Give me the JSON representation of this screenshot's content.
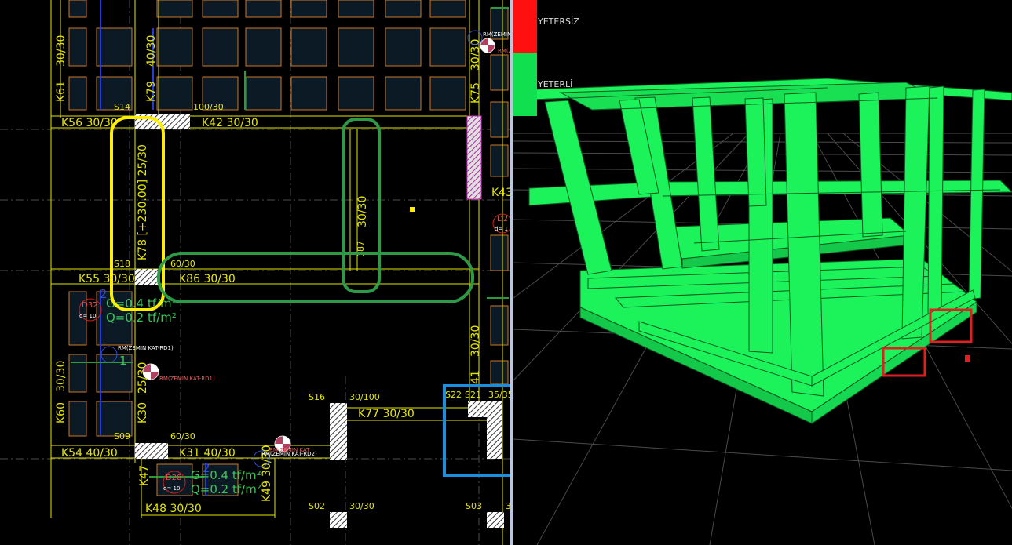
{
  "plan": {
    "beams": {
      "k56": "K56 30/30",
      "k42": "K42   30/30",
      "k55": "K55 30/30",
      "k86": "K86   30/30",
      "k54": "K54 40/30",
      "k31": "K31   40/30",
      "k77": "K77   30/30",
      "k48": "K48   30/30",
      "k61": "K61",
      "k61_size": "30/30",
      "k79": "K79",
      "k79_size": "40/30",
      "k78": "K78 [+230.00]   25/30",
      "k60": "K60",
      "k60_size": "30/30",
      "k30": "K30",
      "k30_size": "25/30",
      "k75": "K75",
      "k75_size": "30/30",
      "k41": "41",
      "k41_size": "30/30",
      "k43": "K43",
      "k47": "K47",
      "k49": "K49",
      "k49_size": "30/30",
      "mid_vertical_size": "30/30",
      "mid_vertical_dim": "187"
    },
    "columns": {
      "s14": "S14",
      "s14_size": "100/30",
      "s18": "S18",
      "s18_size": "60/30",
      "s09": "S09",
      "s09_size": "60/30",
      "s16": "S16",
      "s16_size": "30/100",
      "s22": "S22",
      "s21": "S21",
      "s21_size": "35/35",
      "s02": "S02",
      "s02_size": "30/30",
      "s03": "S03",
      "s03_size": "3"
    },
    "slabs": {
      "d32": "D32",
      "d32_thk": "d= 10",
      "d28": "D28",
      "d28_thk": "d= 10",
      "d2x": "D2",
      "d2x_thk": "d= 1",
      "g1": "G=0.4  tf/m²",
      "q1": "Q=0.2  tf/m²",
      "g2": "G=0.4  tf/m²",
      "q2": "Q=0.2  tf/m²",
      "mark_2a": "2",
      "mark_1a": "1",
      "mark_2b": "2"
    },
    "rm_tags": {
      "rm1": "RM(ZEMIN KAT-RD1)",
      "rm1b": "RM(ZEMIN KAT-RD1)",
      "rm2": "RM(ZEMIN KAT-RD2)",
      "rm2b": "RM(ZEMIN KAT",
      "rm3": "RM(ZEMIN",
      "rm3b": "RM(Z"
    }
  },
  "legend": {
    "insufficient": "YETERSİZ",
    "sufficient": "YETERLİ",
    "insufficient_color": "#ff1010",
    "sufficient_color": "#10e050"
  },
  "colors": {
    "background": "#000000",
    "beam_lines": "#e6e600",
    "grid_cells": "#0b1a24",
    "cell_border": "#c87a2a",
    "axis_blue": "#2a3bd0",
    "structure_green": "#1cf25a",
    "highlight_yellow": "#ffee00",
    "highlight_green": "#2e9a48",
    "highlight_blue": "#1a8fe0",
    "highlight_red": "#e02020"
  }
}
